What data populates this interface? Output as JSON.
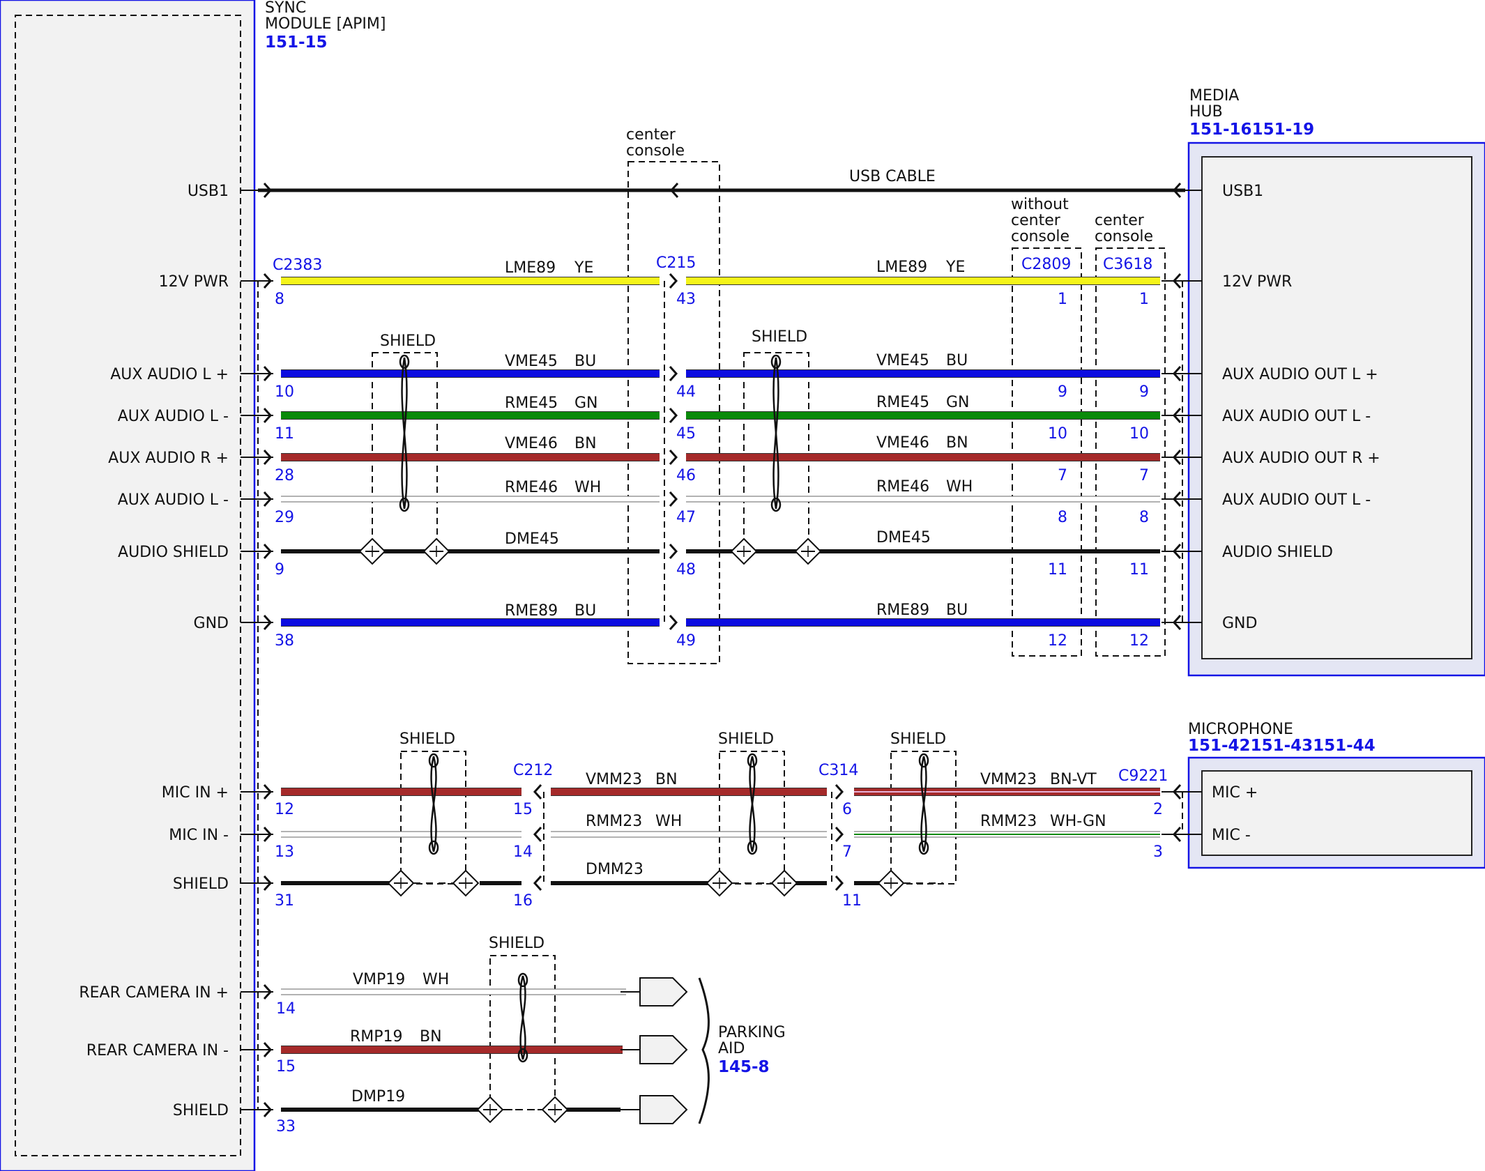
{
  "colors": {
    "yellow": "#f5f51a",
    "blue": "#0c0ce0",
    "green": "#0a8a0a",
    "brown": "#a52a2a",
    "white": "#ffffff",
    "black": "#111111",
    "module_blue": "#1414e6",
    "module_fill": "#f2f2f2"
  },
  "modules": {
    "sync": {
      "name": "SYNC\nMODULE [APIM]",
      "ref": "151-15"
    },
    "media_hub": {
      "name": "MEDIA\nHUB",
      "ref": "151-16151-19"
    },
    "microphone": {
      "name": "MICROPHONE",
      "ref": "151-42151-43151-44"
    },
    "parking_aid": {
      "name": "PARKING\nAID",
      "ref": "145-8"
    }
  },
  "sync_pins": [
    "USB1",
    "12V PWR",
    "AUX AUDIO L +",
    "AUX AUDIO L -",
    "AUX AUDIO R +",
    "AUX AUDIO L -",
    "AUDIO SHIELD",
    "GND",
    "MIC IN +",
    "MIC IN -",
    "SHIELD",
    "REAR CAMERA IN +",
    "REAR CAMERA IN -",
    "SHIELD"
  ],
  "media_hub_pins": [
    "USB1",
    "12V PWR",
    "AUX AUDIO OUT L +",
    "AUX AUDIO OUT L -",
    "AUX AUDIO OUT R +",
    "AUX AUDIO OUT L -",
    "AUDIO SHIELD",
    "GND"
  ],
  "microphone_pins": [
    "MIC +",
    "MIC -"
  ],
  "connectors": {
    "c2383": "C2383",
    "c215": "C215",
    "c2809": "C2809",
    "c3618": "C3618",
    "c212": "C212",
    "c314": "C314",
    "c9221": "C9221"
  },
  "annotations": {
    "center_console_1": "center\nconsole",
    "without_center_console": "without\ncenter\nconsole",
    "center_console_2": "center\nconsole",
    "usb_cable": "USB CABLE",
    "shield": "SHIELD"
  },
  "wires": {
    "w12v_a": {
      "code": "LME89",
      "color": "YE"
    },
    "w12v_b": {
      "code": "LME89",
      "color": "YE"
    },
    "waudl_a": {
      "code": "VME45",
      "color": "BU"
    },
    "waudl_b": {
      "code": "VME45",
      "color": "BU"
    },
    "wauln_a": {
      "code": "RME45",
      "color": "GN"
    },
    "wauln_b": {
      "code": "RME45",
      "color": "GN"
    },
    "waudr_a": {
      "code": "VME46",
      "color": "BN"
    },
    "waudr_b": {
      "code": "VME46",
      "color": "BN"
    },
    "waurn_a": {
      "code": "RME46",
      "color": "WH"
    },
    "waurn_b": {
      "code": "RME46",
      "color": "WH"
    },
    "wshd_a": {
      "code": "DME45",
      "color": ""
    },
    "wshd_b": {
      "code": "DME45",
      "color": ""
    },
    "wgnd_a": {
      "code": "RME89",
      "color": "BU"
    },
    "wgnd_b": {
      "code": "RME89",
      "color": "BU"
    },
    "wmicp_b": {
      "code": "VMM23",
      "color": "BN"
    },
    "wmicp_c": {
      "code": "VMM23",
      "color": "BN-VT"
    },
    "wmicn_b": {
      "code": "RMM23",
      "color": "WH"
    },
    "wmicn_c": {
      "code": "RMM23",
      "color": "WH-GN"
    },
    "wmshd_b": {
      "code": "DMM23",
      "color": ""
    },
    "wcamp": {
      "code": "VMP19",
      "color": "WH"
    },
    "wcamn": {
      "code": "RMP19",
      "color": "BN"
    },
    "wcams": {
      "code": "DMP19",
      "color": ""
    }
  },
  "pin_numbers": {
    "c2383": [
      "8",
      "10",
      "11",
      "28",
      "29",
      "9",
      "38"
    ],
    "c215": [
      "43",
      "44",
      "45",
      "46",
      "47",
      "48",
      "49"
    ],
    "c2809": [
      "1",
      "9",
      "10",
      "7",
      "8",
      "11",
      "12"
    ],
    "c3618": [
      "1",
      "9",
      "10",
      "7",
      "8",
      "11",
      "12"
    ],
    "sync_mic": [
      "12",
      "13",
      "31"
    ],
    "c212": [
      "15",
      "14",
      "16"
    ],
    "c314": [
      "6",
      "7",
      "11"
    ],
    "c9221": [
      "2",
      "3"
    ],
    "sync_cam": [
      "14",
      "15",
      "33"
    ]
  }
}
